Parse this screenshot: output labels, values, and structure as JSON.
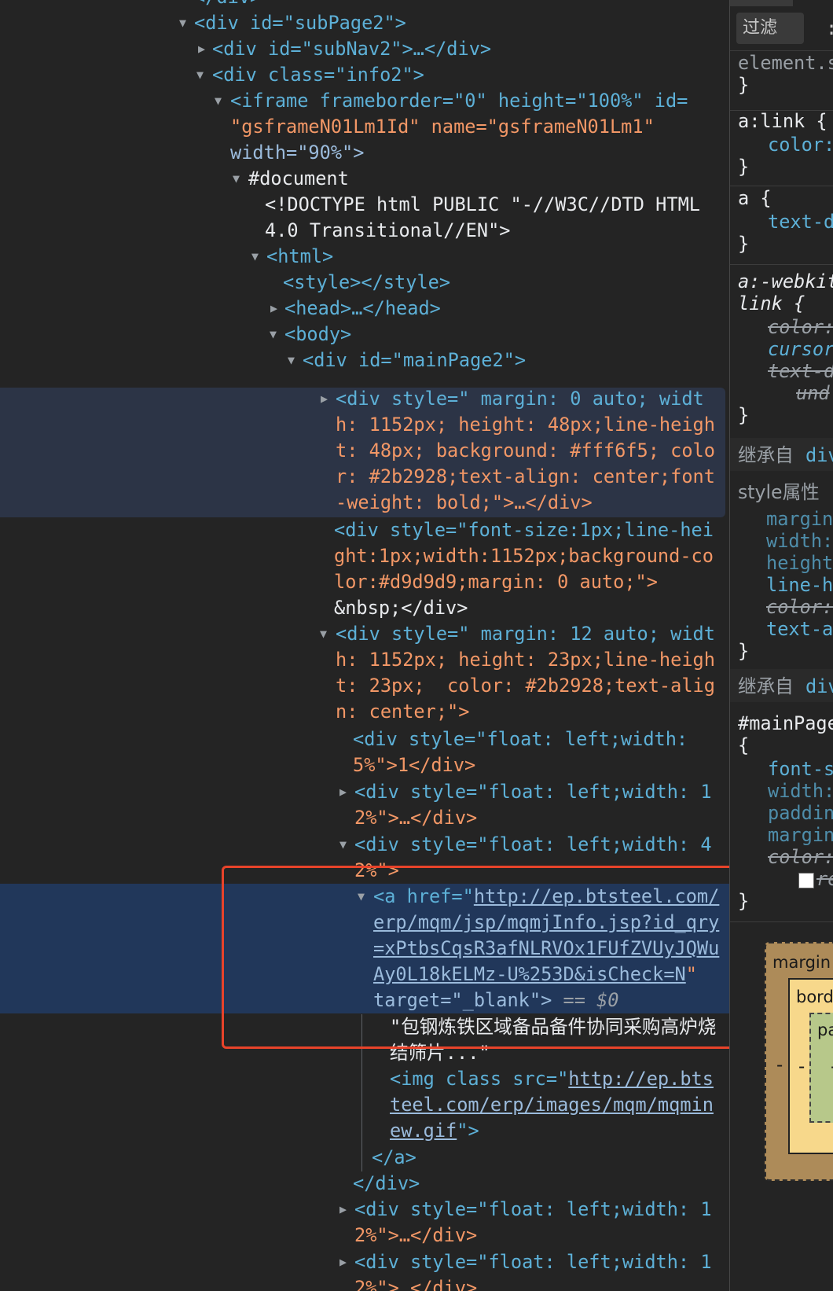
{
  "dom": {
    "top_fragment": "</div>",
    "subpage2": "<div id=\"subPage2\">",
    "subnav2": "<div id=\"subNav2\">…</div>",
    "info2": "<div class=\"info2\">",
    "iframe_l1": "<iframe frameborder=\"0\" height=\"100%\" id=",
    "iframe_l2": "\"gsframeN01Lm1Id\" name=\"gsframeN01Lm1\"",
    "iframe_l3": "width=\"90%\">",
    "document": "#document",
    "doctype_l1": "<!DOCTYPE html PUBLIC \"-//W3C//DTD HTML",
    "doctype_l2": "4.0 Transitional//EN\">",
    "html": "<html>",
    "style": "<style></style>",
    "head": "<head>…</head>",
    "body": "<body>",
    "mainpage2": "<div id=\"mainPage2\">",
    "div1_l1": "<div style=\" margin: 0 auto; widt",
    "div1_l2": "h: 1152px; height: 48px;line-heigh",
    "div1_l3": "t: 48px; background: #fff6f5; colo",
    "div1_l4": "r: #2b2928;text-align: center;font",
    "div1_l5": "-weight: bold;\">…</div>",
    "div2_l1": "<div style=\"font-size:1px;line-hei",
    "div2_l2": "ght:1px;width:1152px;background-co",
    "div2_l3": "lor:#d9d9d9;margin: 0 auto;\">",
    "div2_l4": "&nbsp;</div>",
    "div3_l1": "<div style=\" margin: 12 auto; widt",
    "div3_l2": "h: 1152px; height: 23px;line-heigh",
    "div3_l3": "t: 23px;  color: #2b2928;text-alig",
    "div3_l4": "n: center;\">",
    "f5_l1": "<div style=\"float: left;width:",
    "f5_l2": "5%\">1</div>",
    "f12a_l1": "<div style=\"float: left;width: 1",
    "f12a_l2": "2%\">…</div>",
    "f42_l1": "<div style=\"float: left;width: 4",
    "f42_l2": "2%\">",
    "a_l1_pre": "<a href=\"",
    "a_l1_link": "http://ep.btsteel.com/",
    "a_l2": "erp/mqm/jsp/mqmjInfo.jsp?id_qry",
    "a_l3": "=xPtbsCqsR3afNLRVOx1FUfZVUyJQWu",
    "a_l4": "Ay0L18kELMz-U%253D&isCheck=N",
    "a_l5_attr": "target=\"_blank\">",
    "a_l5_eq": " == $0",
    "text_l1": "\"包钢炼铁区域备品备件协同采购高炉烧",
    "text_l2": "结筛片...\"",
    "img_l1_pre": "<img class src=\"",
    "img_l1_link": "http://ep.bts",
    "img_l2": "teel.com/erp/images/mqm/mqmin",
    "img_l3": "ew.gif",
    "img_l3_end": "\">",
    "a_close": "</a>",
    "div_close": "</div>",
    "f12b_l1": "<div style=\"float: left;width: 1",
    "f12b_l2": "2%\">…</div>",
    "f12c_l1": "<div style=\"float: left;width: 1",
    "f12c_l2": "2%\">…</div>"
  },
  "styles": {
    "filter_label": "过滤",
    "filter_more": ":",
    "element_style": "element.s",
    "close_brace": "}",
    "a_link_sel": "a:link {",
    "color_prop": "color:",
    "a_sel": "a {",
    "text_d": "text-d",
    "webkit_l1": "a:-webkit",
    "webkit_l2": "link {",
    "cursor": "cursor",
    "text_d2": "text-d",
    "und": "und",
    "inherit1": "继承自",
    "inherit_div": "div",
    "style_attr": "style属性",
    "margin": "margin",
    "width": "width:",
    "height": "height",
    "line_h": "line-h",
    "text_a": "text-a",
    "inherit2": "继承自",
    "mainpage": "#mainPage",
    "open_brace": "{",
    "font_s": "font-s",
    "padding": "paddin",
    "margin2": "margin",
    "re": "re",
    "bm_margin": "margin",
    "bm_border": "bord",
    "bm_padding": "pa",
    "dash": "-"
  }
}
